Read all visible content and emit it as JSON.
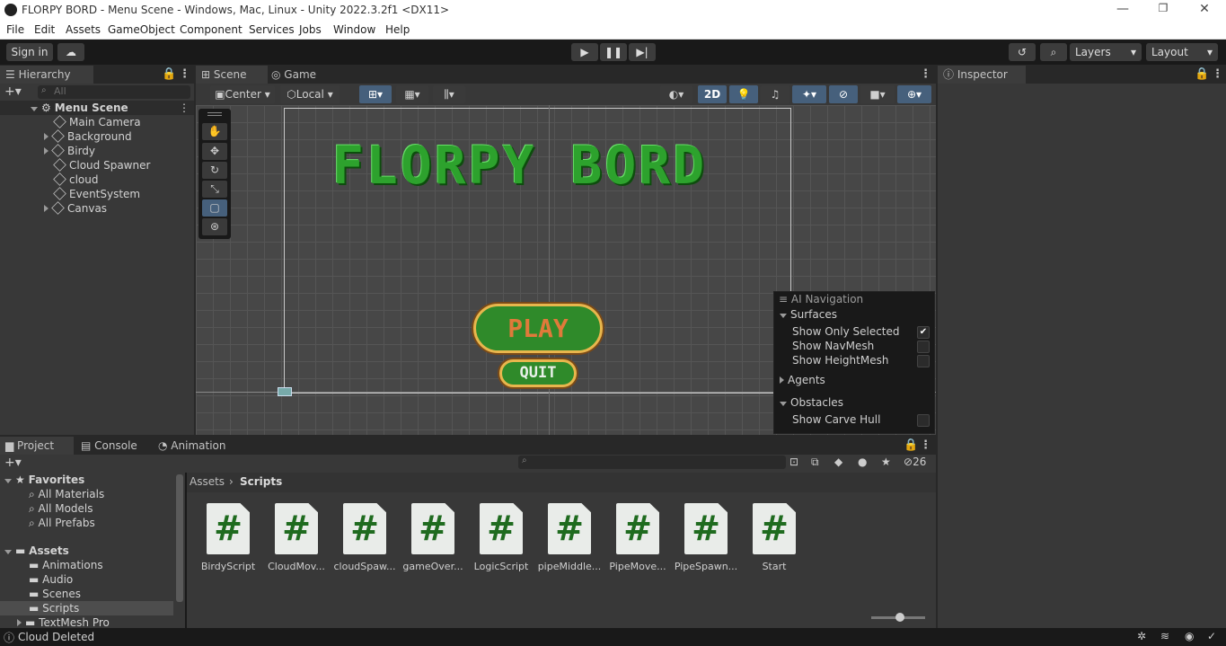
{
  "window": {
    "title": "FLORPY BORD - Menu Scene - Windows, Mac, Linux - Unity 2022.3.2f1 <DX11>"
  },
  "menu": [
    "File",
    "Edit",
    "Assets",
    "GameObject",
    "Component",
    "Services",
    "Jobs",
    "Window",
    "Help"
  ],
  "toolbar": {
    "sign_in": "Sign in",
    "layers": "Layers",
    "layout": "Layout"
  },
  "hierarchy": {
    "tab": "Hierarchy",
    "search_placeholder": "All",
    "scene": "Menu Scene",
    "items": [
      {
        "label": "Main Camera",
        "expandable": false
      },
      {
        "label": "Background",
        "expandable": true
      },
      {
        "label": "Birdy",
        "expandable": true
      },
      {
        "label": "Cloud Spawner",
        "expandable": false
      },
      {
        "label": "cloud",
        "expandable": false
      },
      {
        "label": "EventSystem",
        "expandable": false
      },
      {
        "label": "Canvas",
        "expandable": true
      }
    ]
  },
  "scene_view": {
    "tabs": [
      "Scene",
      "Game"
    ],
    "pivot": "Center",
    "space": "Local",
    "mode_2d": "2D",
    "game_title": "FLORPY BORD",
    "play_button": "PLAY",
    "quit_button": "QUIT"
  },
  "ai_navigation": {
    "title": "AI Navigation",
    "surfaces": "Surfaces",
    "show_only_selected": "Show Only Selected",
    "show_only_selected_checked": true,
    "show_navmesh": "Show NavMesh",
    "show_heightmesh": "Show HeightMesh",
    "agents": "Agents",
    "obstacles": "Obstacles",
    "show_carve_hull": "Show Carve Hull"
  },
  "inspector": {
    "tab": "Inspector"
  },
  "project": {
    "tabs": [
      "Project",
      "Console",
      "Animation"
    ],
    "favorites": {
      "label": "Favorites",
      "items": [
        "All Materials",
        "All Models",
        "All Prefabs"
      ]
    },
    "assets": {
      "label": "Assets",
      "items": [
        "Animations",
        "Audio",
        "Scenes",
        "Scripts",
        "TextMesh Pro"
      ]
    },
    "selected_folder": "Scripts",
    "breadcrumb": [
      "Assets",
      "Scripts"
    ],
    "hidden_count": "26",
    "files": [
      "BirdyScript",
      "CloudMov...",
      "cloudSpaw...",
      "gameOver...",
      "LogicScript",
      "pipeMiddle...",
      "PipeMove...",
      "PipeSpawn...",
      "Start"
    ]
  },
  "status": {
    "message": "Cloud Deleted"
  },
  "colors": {
    "accent_blue": "#46607c",
    "title_green": "#2da22d",
    "button_green": "#2f8a2a",
    "button_border": "#e8b64d"
  }
}
